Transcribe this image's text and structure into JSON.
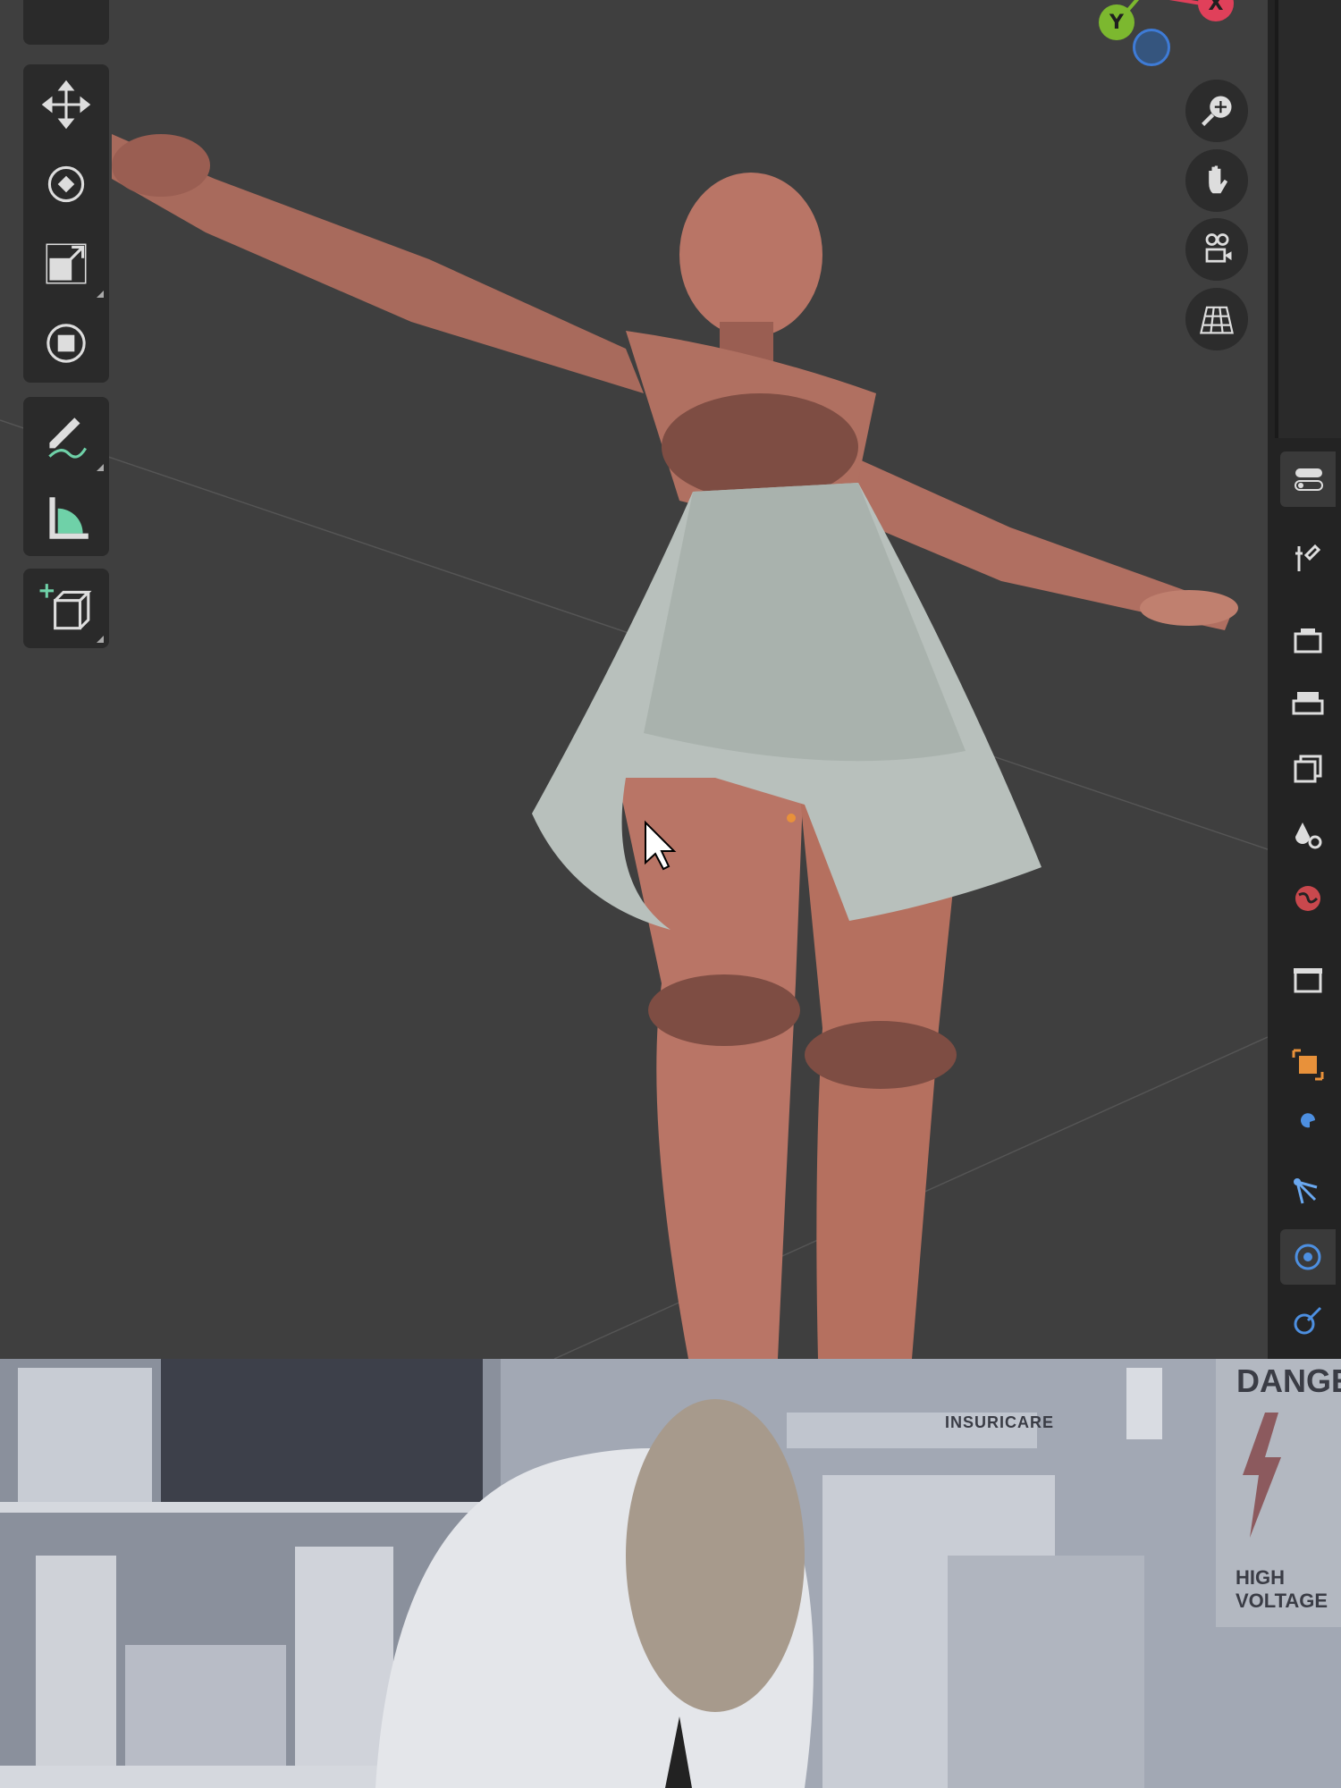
{
  "viewport": {
    "toolbar": [
      {
        "name": "move",
        "icon": "move-icon"
      },
      {
        "name": "rotate",
        "icon": "rotate-icon"
      },
      {
        "name": "scale",
        "icon": "scale-icon"
      },
      {
        "name": "transform",
        "icon": "transform-icon"
      },
      {
        "name": "annotate",
        "icon": "annotate-icon"
      },
      {
        "name": "measure",
        "icon": "measure-icon"
      },
      {
        "name": "add-cube",
        "icon": "add-cube-icon"
      }
    ],
    "gizmo": {
      "x_label": "X",
      "y_label": "Y",
      "x_color": "#e0405a",
      "y_color": "#7cb82f",
      "z_color": "#3e7bd6"
    },
    "nav_buttons": [
      "zoom-icon",
      "hand-pan-icon",
      "camera-icon",
      "grid-perspective-icon"
    ]
  },
  "properties_tabs": [
    "tool",
    "render",
    "output",
    "view-layer",
    "scene",
    "world",
    "collection",
    "object",
    "modifiers",
    "particles",
    "physics",
    "constraints"
  ],
  "meme": {
    "sign_brand": "INSURICARE",
    "sign_danger": "DANGER",
    "sign_voltage": "HIGH VOLTAGE"
  },
  "colors": {
    "skin": "#b97566",
    "skirt": "#b8c0bc",
    "accent": "#e8913a"
  }
}
